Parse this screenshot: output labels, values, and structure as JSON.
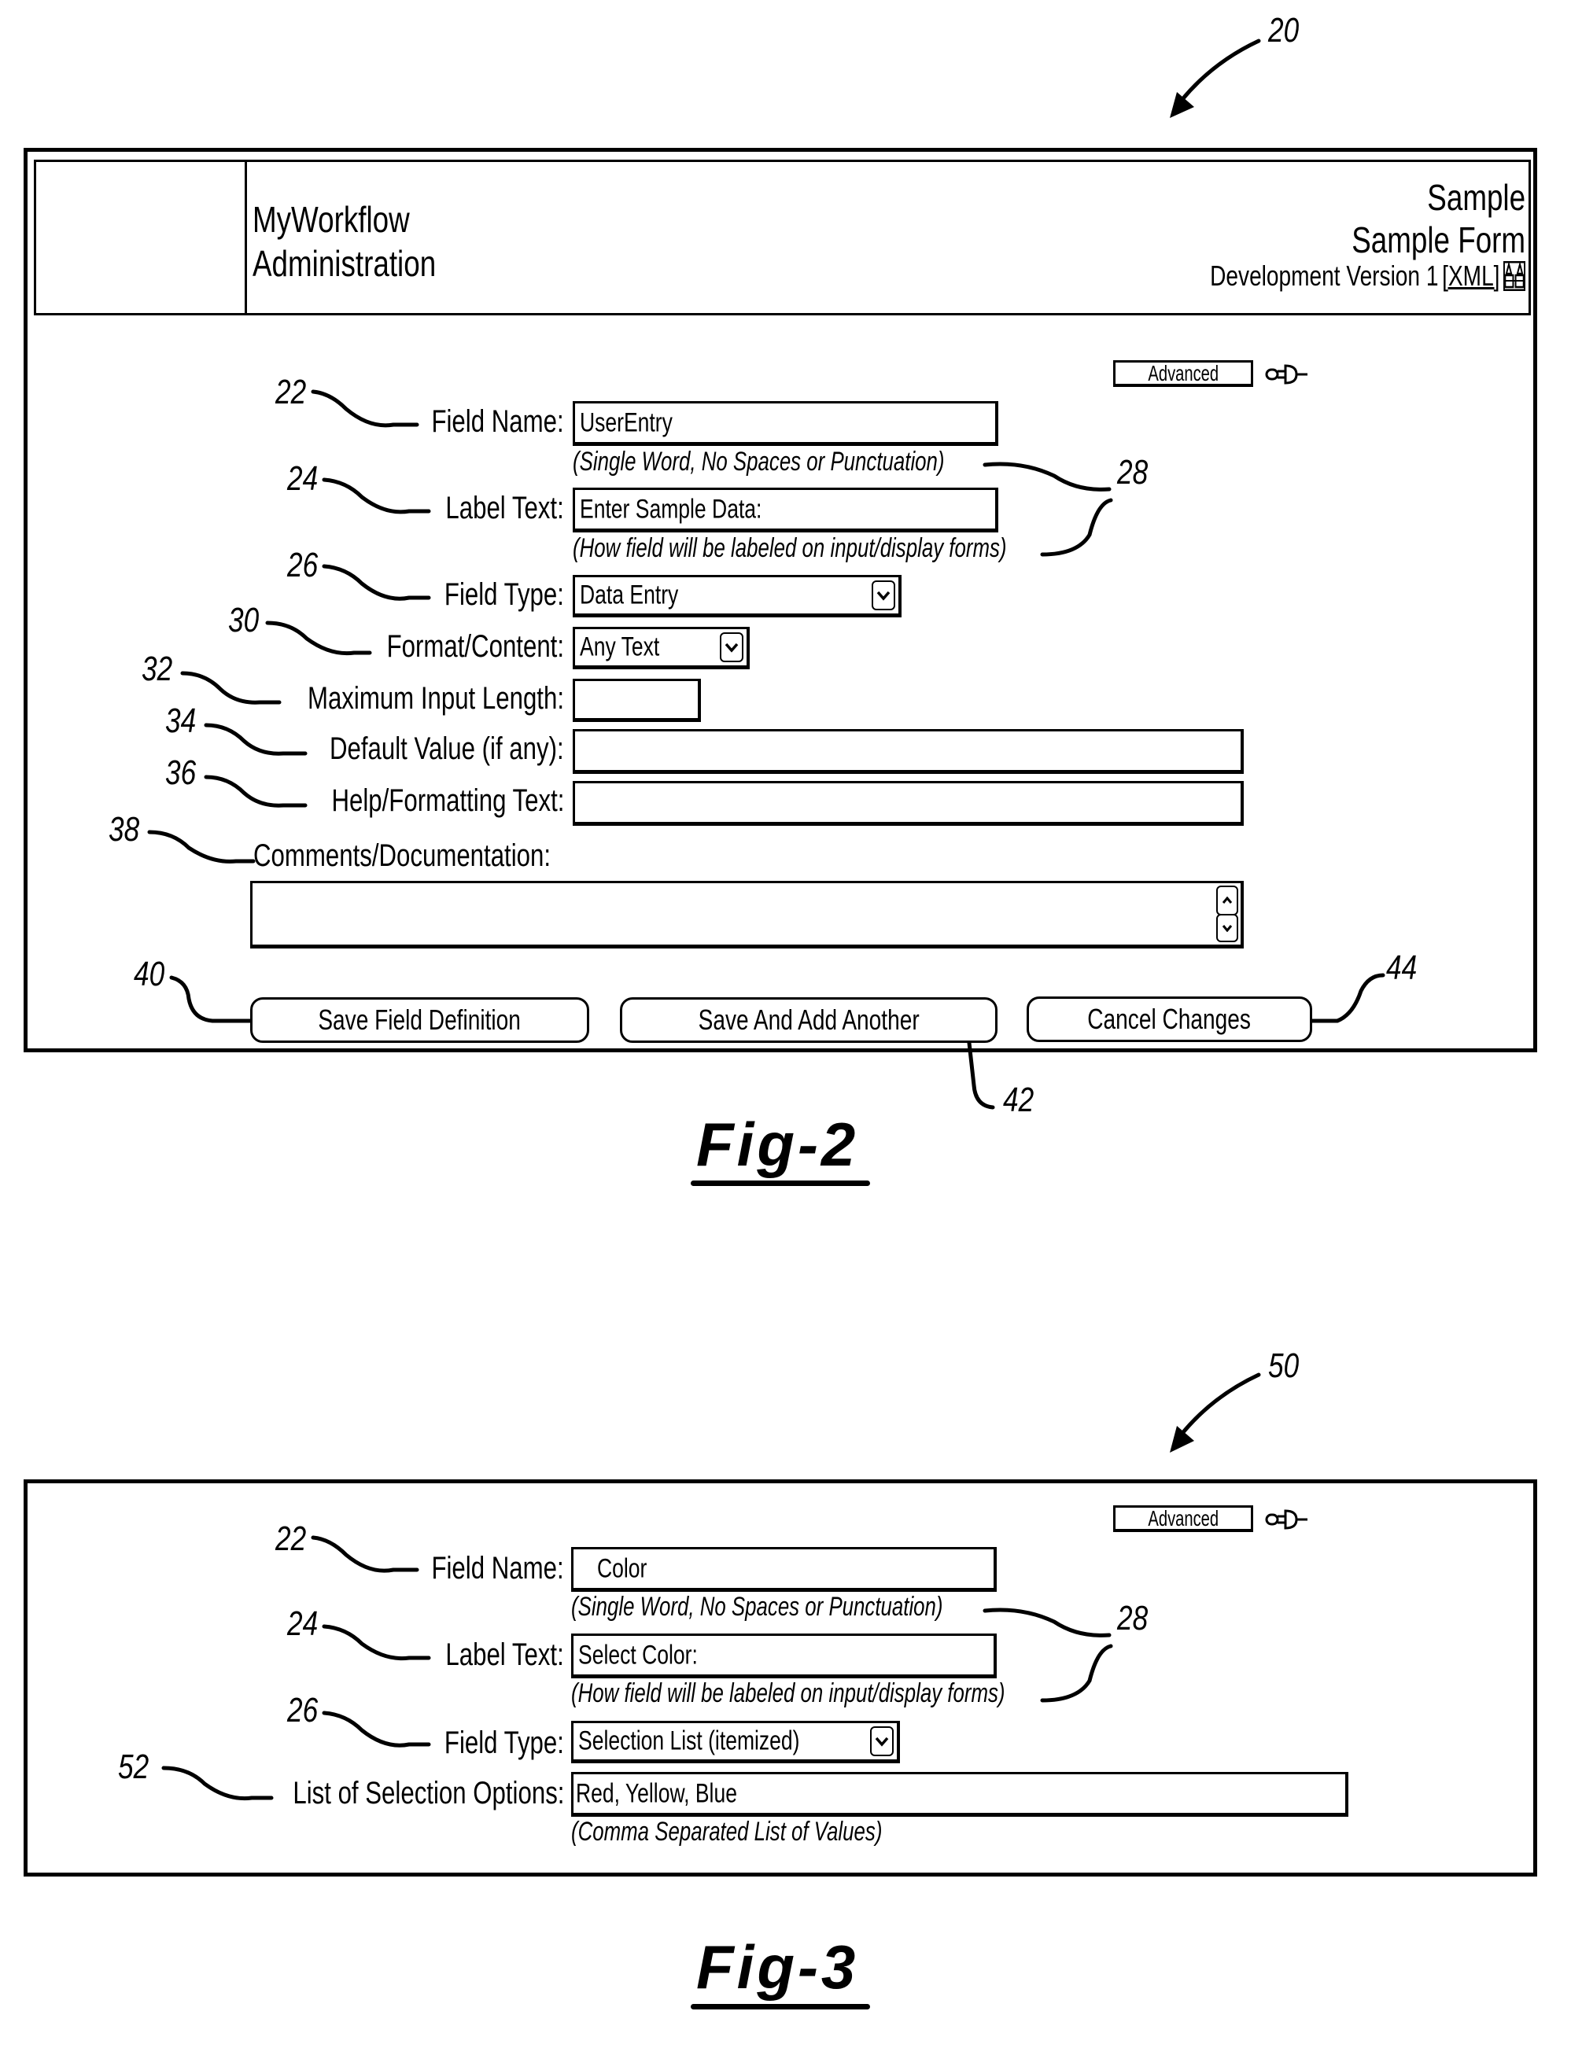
{
  "fig2": {
    "ref_numeral": "20",
    "header": {
      "app_name_line1": "MyWorkflow",
      "app_name_line2": "Administration",
      "right_line1": "Sample",
      "right_line2": "Sample Form",
      "version_text": "Development Version 1",
      "xml_link": "[XML]",
      "view_icon": "binoculars-icon"
    },
    "advanced_button": "Advanced",
    "pin_icon": "pushpin-icon",
    "fields": {
      "field_name": {
        "ref": "22",
        "label": "Field Name:",
        "value": "UserEntry",
        "hint": "(Single Word, No Spaces or Punctuation)"
      },
      "label_text": {
        "ref": "24",
        "label": "Label Text:",
        "value": "Enter Sample Data:",
        "hint": "(How field will be labeled on input/display forms)"
      },
      "hint_ref": "28",
      "field_type": {
        "ref": "26",
        "label": "Field Type:",
        "value": "Data Entry"
      },
      "format_content": {
        "ref": "30",
        "label": "Format/Content:",
        "value": "Any Text"
      },
      "max_length": {
        "ref": "32",
        "label": "Maximum Input Length:",
        "value": ""
      },
      "default_value": {
        "ref": "34",
        "label": "Default Value (if any):",
        "value": ""
      },
      "help_text": {
        "ref": "36",
        "label": "Help/Formatting Text:",
        "value": ""
      },
      "comments": {
        "ref": "38",
        "label": "Comments/Documentation:",
        "value": ""
      }
    },
    "buttons": {
      "save": {
        "ref": "40",
        "label": "Save Field Definition"
      },
      "save_add": {
        "ref": "42",
        "label": "Save And Add Another"
      },
      "cancel": {
        "ref": "44",
        "label": "Cancel Changes"
      }
    },
    "caption": "Fig-2"
  },
  "fig3": {
    "ref_numeral": "50",
    "advanced_button": "Advanced",
    "pin_icon": "pushpin-icon",
    "fields": {
      "field_name": {
        "ref": "22",
        "label": "Field Name:",
        "value": "Color",
        "hint": "(Single Word, No Spaces or Punctuation)"
      },
      "label_text": {
        "ref": "24",
        "label": "Label Text:",
        "value": "Select Color:",
        "hint": "(How field will be labeled on input/display forms)"
      },
      "hint_ref": "28",
      "field_type": {
        "ref": "26",
        "label": "Field Type:",
        "value": "Selection List (itemized)"
      },
      "selection_options": {
        "ref": "52",
        "label": "List of Selection Options:",
        "value": "Red, Yellow, Blue",
        "hint": "(Comma Separated List of Values)"
      }
    },
    "caption": "Fig-3"
  }
}
